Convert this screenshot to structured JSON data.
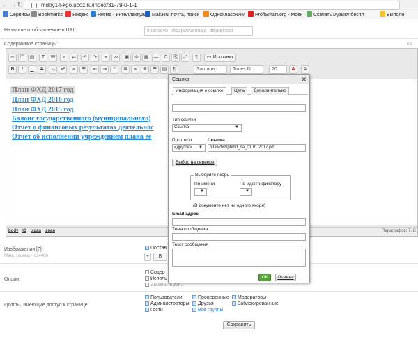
{
  "browser": {
    "url": "mdoy14-kgo.ucoz.ru/index/31-79-0-1-1",
    "bookmarks": [
      "Сервисы",
      "Bookmarks",
      "Яндекс",
      "Нигма - интеллектуал",
      "Mail.Ru: почта, поиск",
      "Одноклассники",
      "ProfiSmart.org - Моек",
      "Скачать музыку беспл",
      "Выполн"
    ]
  },
  "form": {
    "url_label": "Название отображаемое в URL:",
    "url_value": "finansovo_khozjajstvennaja_dejatelnost",
    "content_label": "Содержимое страницы:",
    "images_label": "Изображения [?]:",
    "images_hint": "Макс. размер - 61440b",
    "options_label": "Опции:",
    "groups_label": "Группы, имеющие доступ к странице:",
    "save_label": "Сохранить"
  },
  "toolbar": {
    "source_label": "Источник",
    "format_label": "Заголово...",
    "font_label": "Times N...",
    "size_label": "20",
    "bold": "B",
    "italic": "I",
    "underline": "U",
    "strike": "S"
  },
  "document": {
    "lines": [
      "План ФХД  2017 год",
      "План ФХД 2016 год ",
      "План ФХД 2015 год ",
      "Баланс государственного (муниципального)",
      "Отчет о финансовых результатах деятельнос",
      "Отчет об исполнении учреждением плана ее"
    ]
  },
  "status": {
    "path": [
      "body",
      "h3",
      "span",
      "span"
    ],
    "paragraph": "Параграфов: 7, С"
  },
  "bottom": {
    "image_option": "Постав",
    "options": [
      "Содер",
      "Исполь",
      "Заменить дл..."
    ],
    "groups": [
      {
        "label": "Пользователи",
        "checked": true
      },
      {
        "label": "Проверенные",
        "checked": true
      },
      {
        "label": "Модераторы",
        "checked": true
      },
      {
        "label": "Администраторы",
        "checked": true
      },
      {
        "label": "Друзья",
        "checked": true
      },
      {
        "label": "Заблокированные",
        "checked": true
      },
      {
        "label": "Гости",
        "checked": true
      },
      {
        "label": "Все группы",
        "checked": true
      }
    ]
  },
  "dialog": {
    "title": "Ссылка",
    "tabs": [
      "Информация о ссылке",
      "Цель",
      "Дополнительно"
    ],
    "link_type_label": "Тип ссылки",
    "link_type_value": "Ссылка",
    "protocol_label": "Протокол",
    "protocol_value": "<другой>",
    "link_label": "Ссылка",
    "link_value": "/ctaw/fxd/pfkhd_na_01.01.2017.pdf",
    "browse_server": "Выбор на сервере",
    "anchor_legend": "Выберите якорь",
    "by_name": "По имени",
    "by_id": "По идентификатору",
    "no_anchors": "(В документе нет ни одного якоря)",
    "email_label": "Email адрес",
    "subject_label": "Тема сообщения",
    "body_label": "Текст сообщения",
    "ok": "ОК",
    "cancel": "Отмена"
  }
}
